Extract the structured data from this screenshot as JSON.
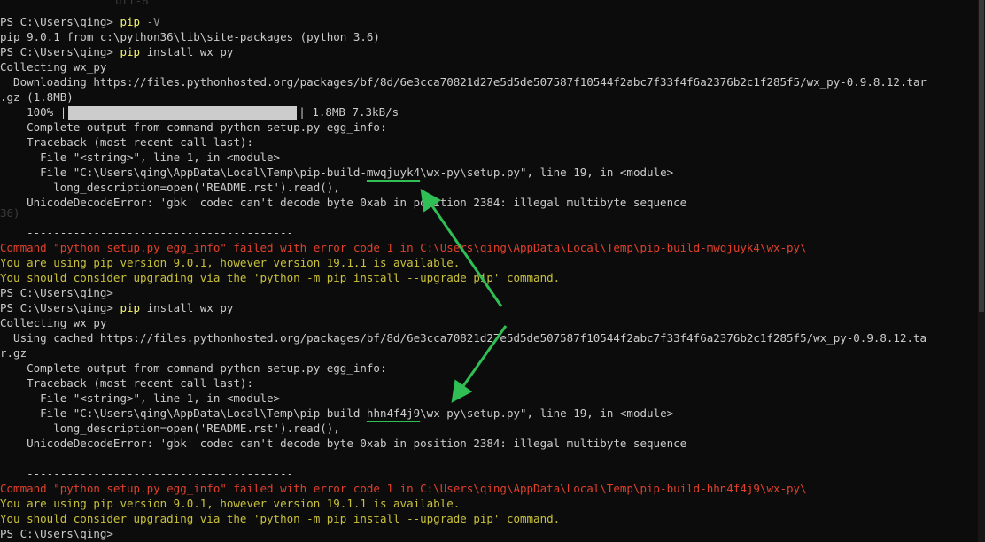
{
  "background_fragments": {
    "top": "utf-8",
    "left_mid": "36)"
  },
  "colors": {
    "text": "#cccccc",
    "command": "#f2f270",
    "error": "#e0402c",
    "warning": "#c9c13a",
    "annotation": "#2fbf55"
  },
  "lines": {
    "l1_prompt": "PS C:\\Users\\qing> ",
    "l1_cmd": "pip",
    "l1_flag": " -V",
    "l2": "pip 9.0.1 from c:\\python36\\lib\\site-packages (python 3.6)",
    "l3_prompt": "PS C:\\Users\\qing> ",
    "l3_cmd": "pip",
    "l3_rest": " install wx_py",
    "l4": "Collecting wx_py",
    "l5": "  Downloading https://files.pythonhosted.org/packages/bf/8d/6e3cca70821d27e5d5de507587f10544f2abc7f33f4f6a2376b2c1f285f5/wx_py-0.9.8.12.tar",
    "l6": ".gz (1.8MB)",
    "l7_pct": "    100% |",
    "l7_end": "| 1.8MB 7.3kB/s",
    "l8": "    Complete output from command python setup.py egg_info:",
    "l9": "    Traceback (most recent call last):",
    "l10": "      File \"<string>\", line 1, in <module>",
    "l11_a": "      File \"C:\\Users\\qing\\AppData\\Local\\Temp\\pip-build-",
    "l11_id": "mwqjuyk4",
    "l11_b": "\\wx-py\\setup.py\", line 19, in <module>",
    "l12": "        long_description=open('README.rst').read(),",
    "l13": "    UnicodeDecodeError: 'gbk' codec can't decode byte 0xab in position 2384: illegal multibyte sequence",
    "l15": "    ----------------------------------------",
    "l16": "Command \"python setup.py egg_info\" failed with error code 1 in C:\\Users\\qing\\AppData\\Local\\Temp\\pip-build-mwqjuyk4\\wx-py\\",
    "l17": "You are using pip version 9.0.1, however version 19.1.1 is available.",
    "l18": "You should consider upgrading via the 'python -m pip install --upgrade pip' command.",
    "l19": "PS C:\\Users\\qing>",
    "l20_prompt": "PS C:\\Users\\qing> ",
    "l20_cmd": "pip",
    "l20_rest": " install wx_py",
    "l21": "Collecting wx_py",
    "l22": "  Using cached https://files.pythonhosted.org/packages/bf/8d/6e3cca70821d27e5d5de507587f10544f2abc7f33f4f6a2376b2c1f285f5/wx_py-0.9.8.12.ta",
    "l23": "r.gz",
    "l24": "    Complete output from command python setup.py egg_info:",
    "l25": "    Traceback (most recent call last):",
    "l26": "      File \"<string>\", line 1, in <module>",
    "l27_a": "      File \"C:\\Users\\qing\\AppData\\Local\\Temp\\pip-build-",
    "l27_id": "hhn4f4j9",
    "l27_b": "\\wx-py\\setup.py\", line 19, in <module>",
    "l28": "        long_description=open('README.rst').read(),",
    "l29": "    UnicodeDecodeError: 'gbk' codec can't decode byte 0xab in position 2384: illegal multibyte sequence",
    "l31": "    ----------------------------------------",
    "l32": "Command \"python setup.py egg_info\" failed with error code 1 in C:\\Users\\qing\\AppData\\Local\\Temp\\pip-build-hhn4f4j9\\wx-py\\",
    "l33": "You are using pip version 9.0.1, however version 19.1.1 is available.",
    "l34": "You should consider upgrading via the 'python -m pip install --upgrade pip' command.",
    "l35": "PS C:\\Users\\qing>"
  },
  "progress": {
    "fraction": 1.0
  }
}
